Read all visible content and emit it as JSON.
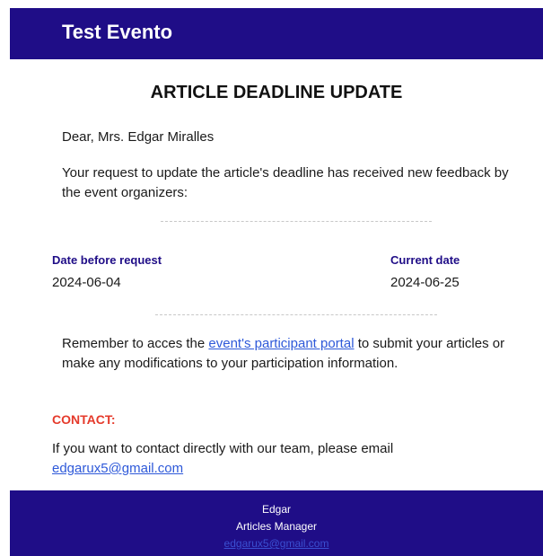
{
  "header": {
    "title": "Test Evento"
  },
  "main": {
    "title": "ARTICLE DEADLINE UPDATE",
    "greeting": "Dear, Mrs. Edgar Miralles",
    "message": "Your request to update the article's deadline has received new feedback by the event organizers:",
    "dates": {
      "before_label": "Date before request",
      "before_value": "2024-06-04",
      "current_label": "Current date",
      "current_value": "2024-06-25"
    },
    "reminder": {
      "prefix": "Remember to acces the ",
      "link_text": "event's participant portal",
      "suffix": " to submit your articles or make any modifications to your participation information."
    },
    "contact": {
      "heading": "CONTACT:",
      "text": "If you want to contact directly with our team, please email",
      "email": "edgarux5@gmail.com"
    }
  },
  "footer": {
    "name": "Edgar",
    "role": "Articles Manager",
    "email": "edgarux5@gmail.com"
  },
  "colors": {
    "brand": "#1f0d87",
    "link": "#2e59d9",
    "contact_heading": "#e53a2b"
  }
}
